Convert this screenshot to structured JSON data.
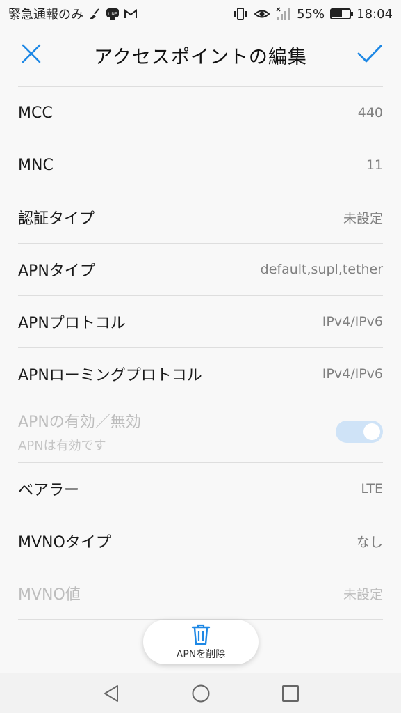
{
  "status_bar": {
    "carrier_text": "緊急通報のみ",
    "battery_percent": "55%",
    "time": "18:04",
    "icons": [
      "broom-icon",
      "line-icon",
      "gmail-icon",
      "vibrate-icon",
      "eye-icon",
      "signal-icon",
      "battery-icon"
    ]
  },
  "header": {
    "title": "アクセスポイントの編集",
    "accent_color": "#1e88e5"
  },
  "settings": {
    "mcc": {
      "label": "MCC",
      "value": "440"
    },
    "mnc": {
      "label": "MNC",
      "value": "11"
    },
    "auth_type": {
      "label": "認証タイプ",
      "value": "未設定"
    },
    "apn_type": {
      "label": "APNタイプ",
      "value": "default,supl,tether"
    },
    "apn_protocol": {
      "label": "APNプロトコル",
      "value": "IPv4/IPv6"
    },
    "apn_roaming_protocol": {
      "label": "APNローミングプロトコル",
      "value": "IPv4/IPv6"
    },
    "apn_enable": {
      "label": "APNの有効／無効",
      "sublabel": "APNは有効です",
      "enabled": true
    },
    "bearer": {
      "label": "ベアラー",
      "value": "LTE"
    },
    "mvno_type": {
      "label": "MVNOタイプ",
      "value": "なし"
    },
    "mvno_value": {
      "label": "MVNO値",
      "value": "未設定"
    }
  },
  "fab": {
    "label": "APNを削除"
  },
  "nav_bar": {
    "icons": [
      "back-icon",
      "home-icon",
      "recents-icon"
    ]
  }
}
